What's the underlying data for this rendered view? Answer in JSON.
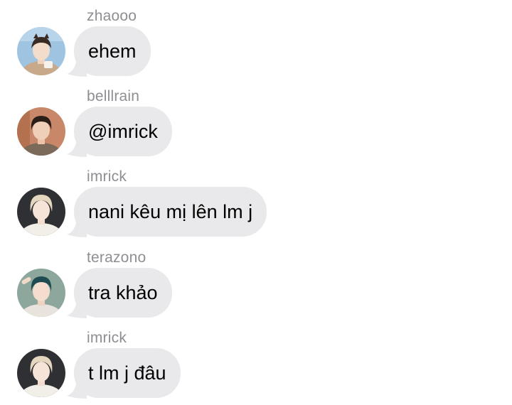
{
  "theme": {
    "bubble_color": "#e9e9eb",
    "sender_color": "#8e8e93",
    "text_color": "#000000",
    "background": "#ffffff"
  },
  "messages": [
    {
      "sender": "zhaooo",
      "text": "ehem",
      "avatar": "avatar-zhaooo",
      "avatar_bg": "#9fc4e2",
      "avatar_hair": "#3a2a24",
      "avatar_shirt": "#c8a98a"
    },
    {
      "sender": "belllrain",
      "text": "@imrick",
      "avatar": "avatar-belllrain",
      "avatar_bg": "#c9876a",
      "avatar_hair": "#2b1e18",
      "avatar_shirt": "#7b6a5a"
    },
    {
      "sender": "imrick",
      "text": "nani kêu mị lên lm j",
      "avatar": "avatar-imrick",
      "avatar_bg": "#2f3033",
      "avatar_hair": "#e4d6bf",
      "avatar_shirt": "#f2efe9"
    },
    {
      "sender": "terazono",
      "text": "tra khảo",
      "avatar": "avatar-terazono",
      "avatar_bg": "#8da79c",
      "avatar_hair": "#1e4a52",
      "avatar_shirt": "#e8e4dd"
    },
    {
      "sender": "imrick",
      "text": "t lm j đâu",
      "avatar": "avatar-imrick",
      "avatar_bg": "#2f3033",
      "avatar_hair": "#e4d6bf",
      "avatar_shirt": "#f2efe9"
    }
  ]
}
